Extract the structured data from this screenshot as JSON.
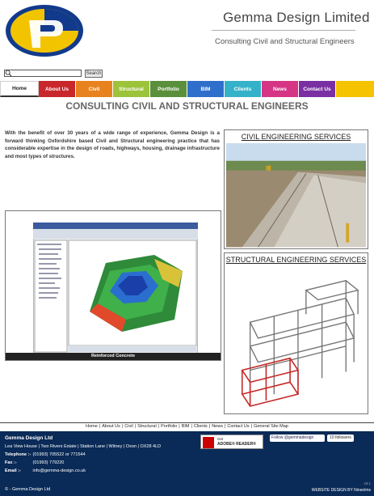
{
  "header": {
    "brand": "Gemma Design Limited",
    "tagline": "Consulting Civil and Structural Engineers"
  },
  "search": {
    "value": "",
    "button_label": "Search"
  },
  "nav": {
    "items": [
      {
        "label": "Home",
        "color": "#ffffff"
      },
      {
        "label": "About Us",
        "color": "#c8272b"
      },
      {
        "label": "Civil",
        "color": "#e8821e"
      },
      {
        "label": "Structural",
        "color": "#9cc33a"
      },
      {
        "label": "Portfolio",
        "color": "#5a8f3b"
      },
      {
        "label": "BIM",
        "color": "#2f6fcc"
      },
      {
        "label": "Clients",
        "color": "#34b2c9"
      },
      {
        "label": "News",
        "color": "#d63585"
      },
      {
        "label": "Contact Us",
        "color": "#7a2fa3"
      }
    ],
    "tail_color": "#f5c300"
  },
  "main": {
    "title": "CONSULTING CIVIL AND STRUCTURAL ENGINEERS",
    "intro": "With the benefit of over 30 years of a wide range of experience, Gemma Design is a forward thinking Oxfordshire based Civil and Structural engineering practice that has considerable expertise in the design of roads, highways, housing, drainage infrastructure and most types of structures.",
    "civil_title": "CIVIL ENGINEERING SERVICES",
    "structural_title": "STRUCTURAL ENGINEERING SERVICES",
    "software_caption": "Reinforced Concrete"
  },
  "footer_links": [
    "Home",
    "About Us",
    "Civil",
    "Structural",
    "Portfolio",
    "BIM",
    "Clients",
    "News",
    "Contact Us",
    "General Site Map"
  ],
  "footer": {
    "company": "Gemma Design Ltd",
    "address": "Lea View House | Two Rivers Estate | Station Lane | Witney | Oxon | OX28 4LD",
    "telephone_label": "Telephone :-",
    "telephone": "(01993) 705522 or 771544",
    "fax_label": "Fax :-",
    "fax": "(01993) 779220",
    "email_label": "Email :-",
    "email": "info@gemma-design.co.uk",
    "copyright": "© - Gemma Design Ltd",
    "credit": "WEBSITE DESIGN BY Nineelms",
    "version": "v3.1",
    "adobe_get": "Get",
    "adobe_name": "ADOBE® READER®",
    "twitter": "Follow @gemmadesign",
    "followers": "10 followers"
  }
}
